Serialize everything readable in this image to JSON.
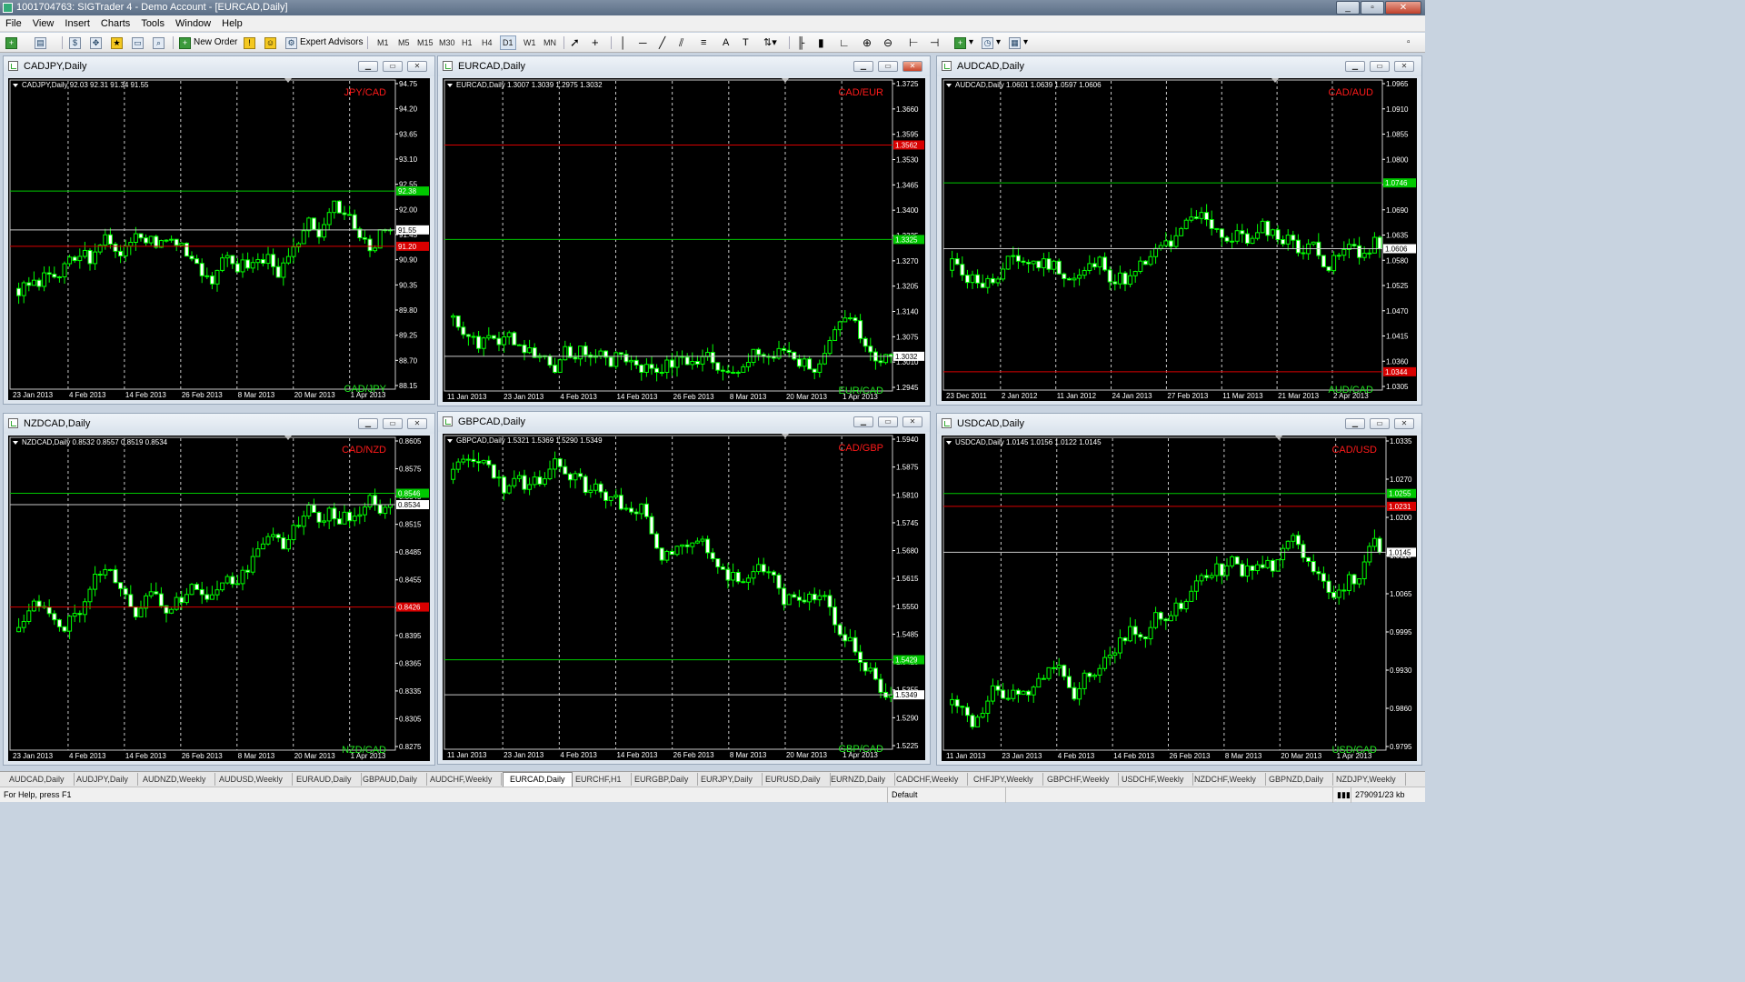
{
  "window": {
    "title": "1001704763: SIGTrader 4 - Demo Account - [EURCAD,Daily]",
    "minimize": "_",
    "restore": "▫",
    "close": "✕"
  },
  "menu": [
    "File",
    "View",
    "Insert",
    "Charts",
    "Tools",
    "Window",
    "Help"
  ],
  "toolbar": {
    "new_order": "New Order",
    "expert_advisors": "Expert Advisors",
    "timeframes": [
      "M1",
      "M5",
      "M15",
      "M30",
      "H1",
      "H4",
      "D1",
      "W1",
      "MN"
    ],
    "active_timeframe": "D1",
    "draw_text": "A",
    "text_label": "T",
    "icons": [
      "new-chart-icon",
      "profiles-icon",
      "market-watch-icon",
      "navigator-icon",
      "favorites-icon",
      "terminal-icon",
      "tester-icon",
      "new-order-icon",
      "metaeditor-icon",
      "autotrading-icon",
      "expert-advisors-icon",
      "cursor-icon",
      "crosshair-icon",
      "vertical-line-icon",
      "horizontal-line-icon",
      "trendline-icon",
      "channel-icon",
      "fibonacci-icon",
      "text-icon",
      "text-label-icon",
      "arrows-icon",
      "bar-chart-icon",
      "candlestick-icon",
      "line-chart-icon",
      "zoom-in-icon",
      "zoom-out-icon",
      "tile-windows-icon",
      "autoscroll-icon",
      "chart-shift-icon",
      "indicators-icon",
      "periods-icon",
      "templates-icon"
    ]
  },
  "colors": {
    "bull_candle": "#000000",
    "bear_candle": "#ffffff",
    "candle_outline": "#00ff00",
    "grid": "#c8c8c8",
    "support_line": "#00c800",
    "resistance_line": "#d80000",
    "price_line": "#c8c8c8",
    "inverse_label": "#ff1a1a",
    "symbol_label": "#22e622"
  },
  "charts": [
    {
      "window_title": "CADJPY,Daily",
      "info": "CADJPY,Daily  92.03 92.31 91.34 91.55",
      "inverse": "JPY/CAD",
      "symbol": "CAD/JPY",
      "y_ticks": [
        "94.75",
        "94.20",
        "93.65",
        "93.10",
        "92.55",
        "92.00",
        "91.45",
        "90.90",
        "90.35",
        "89.80",
        "89.25",
        "88.70",
        "88.15"
      ],
      "x_ticks": [
        "23 Jan 2013",
        "4 Feb 2013",
        "14 Feb 2013",
        "26 Feb 2013",
        "8 Mar 2013",
        "20 Mar 2013",
        "1 Apr 2013"
      ],
      "lines": [
        {
          "kind": "support",
          "value": 92.38,
          "label": "92.38"
        },
        {
          "kind": "price",
          "value": 91.55,
          "label": "91.55"
        },
        {
          "kind": "resistance",
          "value": 91.2,
          "label": "91.20"
        }
      ],
      "ymin": 88.15,
      "ymax": 94.75,
      "start": 90.3,
      "end": 91.55,
      "seed": 3
    },
    {
      "window_title": "EURCAD,Daily",
      "info": "EURCAD,Daily  1.3007 1.3039 1.2975 1.3032",
      "inverse": "CAD/EUR",
      "symbol": "EUR/CAD",
      "y_ticks": [
        "1.3725",
        "1.3660",
        "1.3595",
        "1.3530",
        "1.3465",
        "1.3400",
        "1.3335",
        "1.3270",
        "1.3205",
        "1.3140",
        "1.3075",
        "1.3010",
        "1.2945"
      ],
      "x_ticks": [
        "11 Jan 2013",
        "23 Jan 2013",
        "4 Feb 2013",
        "14 Feb 2013",
        "26 Feb 2013",
        "8 Mar 2013",
        "20 Mar 2013",
        "1 Apr 2013"
      ],
      "lines": [
        {
          "kind": "resistance",
          "value": 1.3562,
          "label": "1.3562"
        },
        {
          "kind": "support",
          "value": 1.3325,
          "label": "1.3325"
        },
        {
          "kind": "price",
          "value": 1.3032,
          "label": "1.3032"
        }
      ],
      "ymin": 1.2945,
      "ymax": 1.3725,
      "start": 1.313,
      "end": 1.3032,
      "seed": 7
    },
    {
      "window_title": "AUDCAD,Daily",
      "info": "AUDCAD,Daily  1.0601 1.0639 1.0597 1.0606",
      "inverse": "CAD/AUD",
      "symbol": "AUD/CAD",
      "y_ticks": [
        "1.0965",
        "1.0910",
        "1.0855",
        "1.0800",
        "1.0745",
        "1.0690",
        "1.0635",
        "1.0580",
        "1.0525",
        "1.0470",
        "1.0415",
        "1.0360",
        "1.0305"
      ],
      "x_ticks": [
        "23 Dec 2011",
        "2 Jan 2012",
        "11 Jan 2012",
        "24 Jan 2013",
        "27 Feb 2013",
        "11 Mar 2013",
        "21 Mar 2013",
        "2 Apr 2013"
      ],
      "lines": [
        {
          "kind": "support",
          "value": 1.0746,
          "label": "1.0746"
        },
        {
          "kind": "price",
          "value": 1.0606,
          "label": "1.0606"
        },
        {
          "kind": "resistance",
          "value": 1.0344,
          "label": "1.0344"
        }
      ],
      "ymin": 1.0305,
      "ymax": 1.0965,
      "start": 1.056,
      "end": 1.0606,
      "seed": 11
    },
    {
      "window_title": "NZDCAD,Daily",
      "info": "NZDCAD,Daily  0.8532 0.8557 0.8519 0.8534",
      "inverse": "CAD/NZD",
      "symbol": "NZD/CAD",
      "y_ticks": [
        "0.8605",
        "0.8575",
        "0.8545",
        "0.8515",
        "0.8485",
        "0.8455",
        "0.8425",
        "0.8395",
        "0.8365",
        "0.8335",
        "0.8305",
        "0.8275"
      ],
      "x_ticks": [
        "23 Jan 2013",
        "4 Feb 2013",
        "14 Feb 2013",
        "26 Feb 2013",
        "8 Mar 2013",
        "20 Mar 2013",
        "1 Apr 2013"
      ],
      "lines": [
        {
          "kind": "support",
          "value": 0.8546,
          "label": "0.8546"
        },
        {
          "kind": "price",
          "value": 0.8534,
          "label": "0.8534"
        },
        {
          "kind": "resistance",
          "value": 0.8426,
          "label": "0.8426"
        }
      ],
      "ymin": 0.8275,
      "ymax": 0.8605,
      "start": 0.84,
      "end": 0.8534,
      "seed": 19
    },
    {
      "window_title": "GBPCAD,Daily",
      "info": "GBPCAD,Daily  1.5321 1.5369 1.5290 1.5349",
      "inverse": "CAD/GBP",
      "symbol": "GBP/CAD",
      "y_ticks": [
        "1.5940",
        "1.5875",
        "1.5810",
        "1.5745",
        "1.5680",
        "1.5615",
        "1.5550",
        "1.5485",
        "1.5420",
        "1.5355",
        "1.5290",
        "1.5225"
      ],
      "x_ticks": [
        "11 Jan 2013",
        "23 Jan 2013",
        "4 Feb 2013",
        "14 Feb 2013",
        "26 Feb 2013",
        "8 Mar 2013",
        "20 Mar 2013",
        "1 Apr 2013"
      ],
      "lines": [
        {
          "kind": "support",
          "value": 1.5429,
          "label": "1.5429"
        },
        {
          "kind": "price",
          "value": 1.5349,
          "label": "1.5349"
        }
      ],
      "ymin": 1.5225,
      "ymax": 1.594,
      "start": 1.584,
      "end": 1.5349,
      "seed": 23
    },
    {
      "window_title": "USDCAD,Daily",
      "info": "USDCAD,Daily  1.0145 1.0156 1.0122 1.0145",
      "inverse": "CAD/USD",
      "symbol": "USD/CAD",
      "y_ticks": [
        "1.0335",
        "1.0270",
        "1.0200",
        "1.0110",
        "1.0065",
        "0.9995",
        "0.9930",
        "0.9860",
        "0.9795"
      ],
      "x_ticks": [
        "11 Jan 2013",
        "23 Jan 2013",
        "4 Feb 2013",
        "14 Feb 2013",
        "26 Feb 2013",
        "8 Mar 2013",
        "20 Mar 2013",
        "1 Apr 2013"
      ],
      "lines": [
        {
          "kind": "support",
          "value": 1.0255,
          "label": "1.0255"
        },
        {
          "kind": "resistance",
          "value": 1.0231,
          "label": "1.0231"
        },
        {
          "kind": "price",
          "value": 1.0145,
          "label": "1.0145"
        }
      ],
      "ymin": 0.9775,
      "ymax": 1.036,
      "start": 0.986,
      "end": 1.0145,
      "seed": 31
    }
  ],
  "tabs": [
    "AUDCAD,Daily",
    "AUDJPY,Daily",
    "AUDNZD,Weekly",
    "AUDUSD,Weekly",
    "EURAUD,Daily",
    "GBPAUD,Daily",
    "AUDCHF,Weekly",
    "EURCAD,Daily",
    "EURCHF,H1",
    "EURGBP,Daily",
    "EURJPY,Daily",
    "EURUSD,Daily",
    "EURNZD,Daily",
    "CADCHF,Weekly",
    "CHFJPY,Weekly",
    "GBPCHF,Weekly",
    "USDCHF,Weekly",
    "NZDCHF,Weekly",
    "GBPNZD,Daily",
    "NZDJPY,Weekly"
  ],
  "active_tab": "EURCAD,Daily",
  "status": {
    "help": "For Help, press F1",
    "profile": "Default",
    "traffic": "279091/23 kb"
  }
}
